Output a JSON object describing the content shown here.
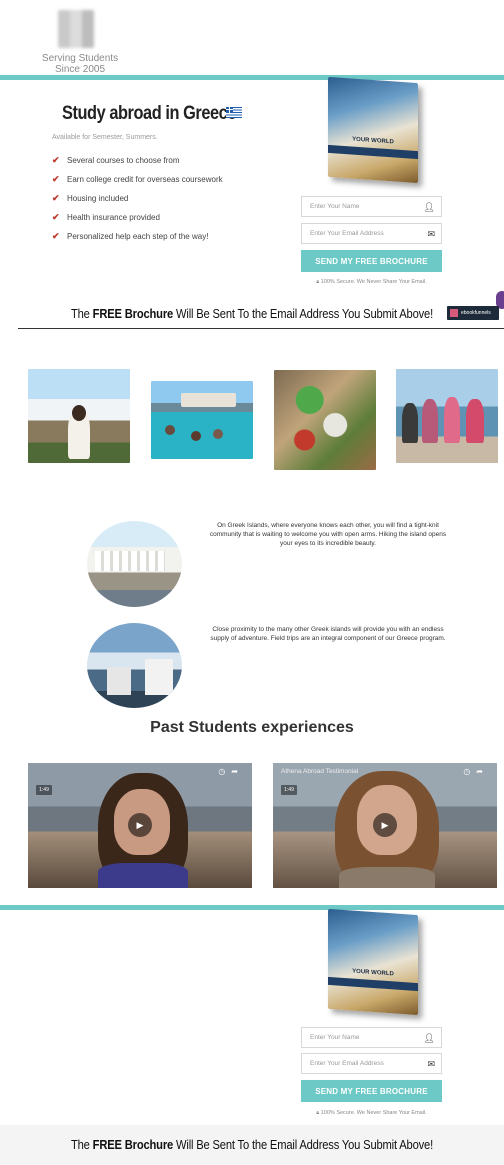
{
  "header": {
    "tagline_line1": "Serving Students",
    "tagline_line2": "Since 2005"
  },
  "hero": {
    "title": "Study abroad in Greece",
    "flag_icon": "greek-flag-icon",
    "subtitle": "Available for Semester, Summers.",
    "features": [
      "Several courses to choose from",
      "Earn college credit for overseas coursework",
      "Housing included",
      "Health insurance provided",
      "Personalized help each step of the way!"
    ]
  },
  "book": {
    "cover_text": "YOUR WORLD"
  },
  "form": {
    "name_placeholder": "Enter Your Name",
    "email_placeholder": "Enter Your Email Address",
    "submit_label": "SEND MY FREE BROCHURE",
    "secure_note": "100% Secure. We Never Share Your Email."
  },
  "banner": {
    "prefix": "The ",
    "bold": "FREE Brochure",
    "suffix": " Will Be Sent To the Email Address You Submit Above!"
  },
  "badge": {
    "label": "ebookfunnels"
  },
  "features_text": {
    "para1": "On Greek Islands, where everyone knows each other, you will find a tight-knit community that is waiting to welcome you with open arms. Hiking the island opens your eyes to its incredible beauty.",
    "para2": "Close proximity to the many other Greek islands will provide you with an endless supply of adventure. Field trips are an integral component of our Greece program."
  },
  "testimonials": {
    "title": "Past Students experiences",
    "videos": [
      {
        "title": "",
        "time": "1:49"
      },
      {
        "title": "Athena Abroad Testimonial",
        "time": "1:49"
      }
    ]
  },
  "colors": {
    "accent": "#6cc9c6",
    "check": "#c0392b"
  }
}
